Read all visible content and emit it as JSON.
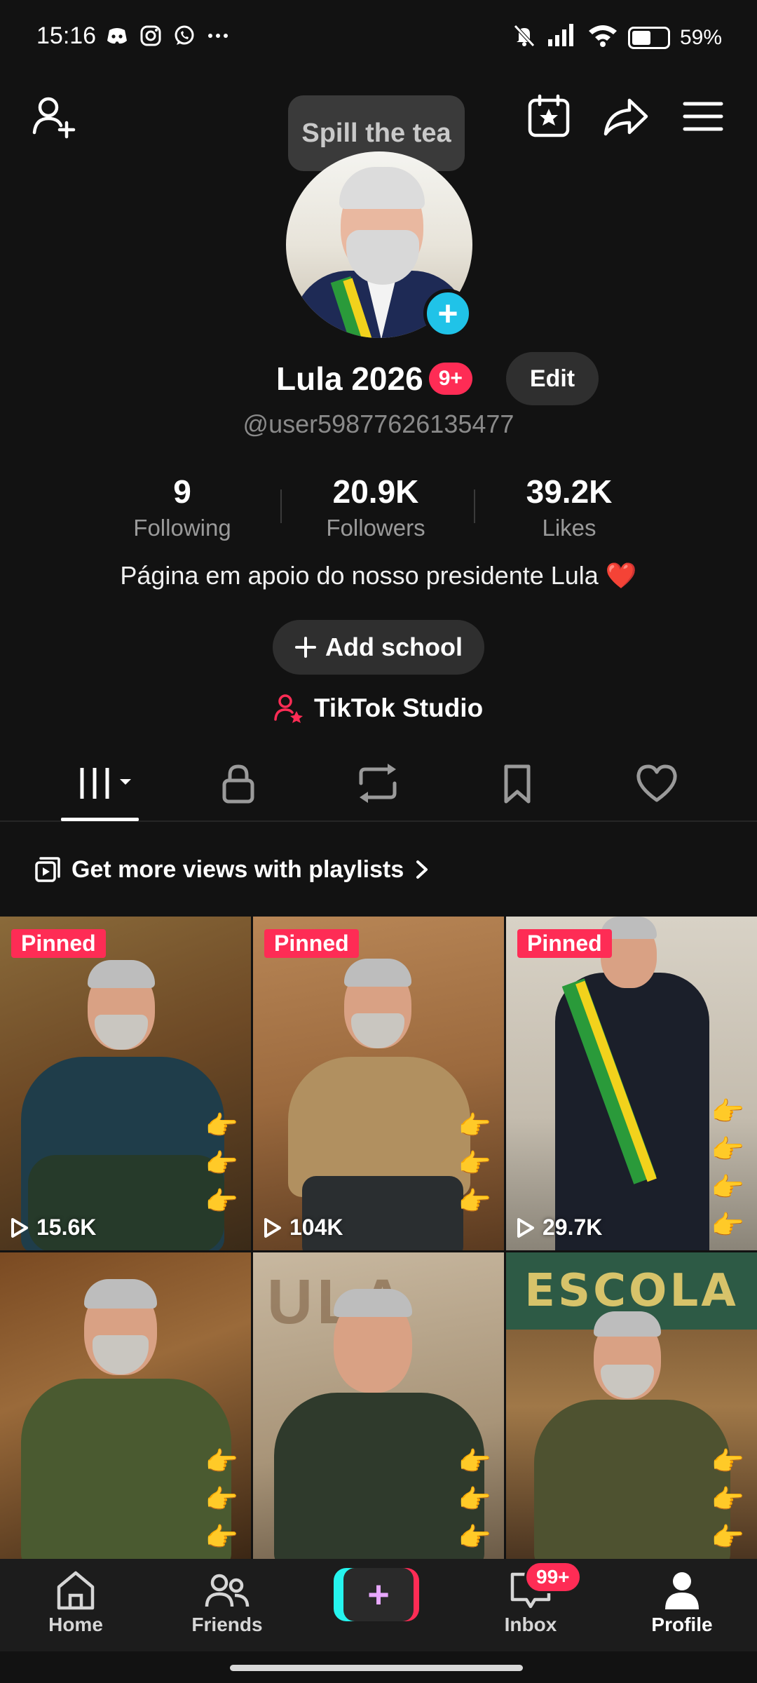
{
  "status_bar": {
    "time": "15:16",
    "battery": "59%"
  },
  "header": {
    "tooltip": "Spill the tea"
  },
  "profile": {
    "display_name": "Lula 2026",
    "name_badge": "9+",
    "edit_label": "Edit",
    "username": "@user59877626135477",
    "stats": [
      {
        "value": "9",
        "label": "Following"
      },
      {
        "value": "20.9K",
        "label": "Followers"
      },
      {
        "value": "39.2K",
        "label": "Likes"
      }
    ],
    "bio": "Página em apoio do nosso presidente Lula",
    "bio_emoji": "❤️",
    "add_school_label": "Add school",
    "studio_label": "TikTok Studio"
  },
  "playlist_banner": "Get more views with playlists",
  "videos": [
    {
      "pinned_label": "Pinned",
      "views": "15.6K"
    },
    {
      "pinned_label": "Pinned",
      "views": "104K"
    },
    {
      "pinned_label": "Pinned",
      "views": "29.7K"
    },
    {
      "pinned_label": "",
      "views": ""
    },
    {
      "pinned_label": "",
      "views": ""
    },
    {
      "pinned_label": "",
      "views": ""
    }
  ],
  "video_texts": {
    "wall": "ULA",
    "sign": "ESCOLA"
  },
  "bottom_nav": {
    "home": "Home",
    "friends": "Friends",
    "inbox": "Inbox",
    "inbox_badge": "99+",
    "profile": "Profile"
  },
  "colors": {
    "accent": "#fe2c55",
    "cyan": "#25f4ee",
    "plus_badge": "#20c3e8",
    "background": "#121212"
  }
}
